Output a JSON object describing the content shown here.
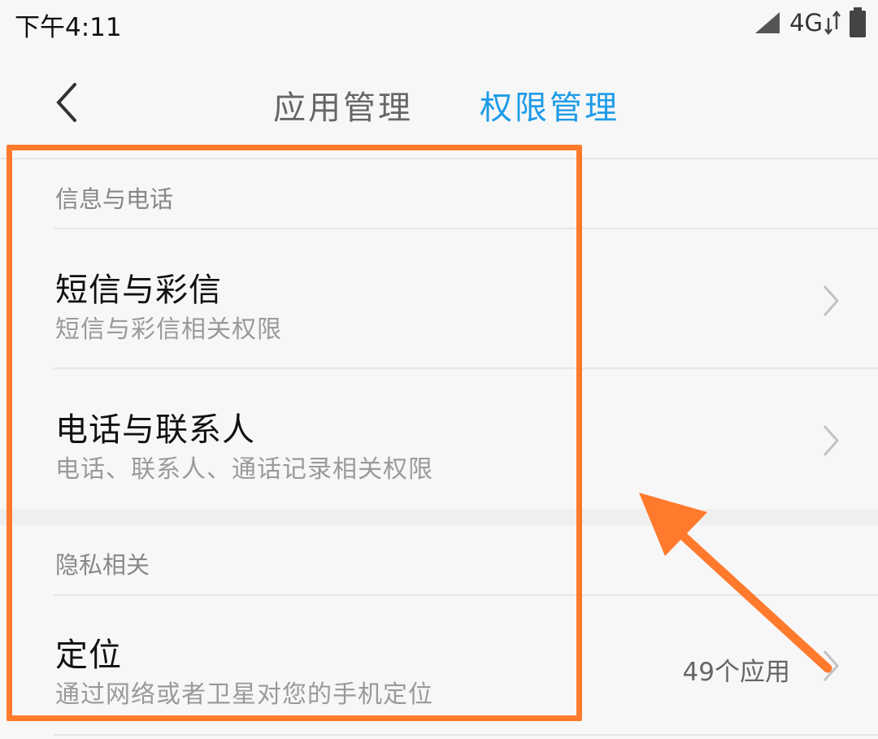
{
  "status_bar": {
    "time": "下午4:11",
    "network": "4G",
    "icons": [
      "signal-icon",
      "data-arrows-icon",
      "battery-icon"
    ]
  },
  "title_bar": {
    "back_icon": "chevron-left-icon",
    "tabs": [
      {
        "label": "应用管理",
        "active": false
      },
      {
        "label": "权限管理",
        "active": true
      }
    ],
    "active_color": "#1e9be8"
  },
  "sections": [
    {
      "header": "信息与电话",
      "items": [
        {
          "title": "短信与彩信",
          "subtitle": "短信与彩信相关权限",
          "meta": ""
        },
        {
          "title": "电话与联系人",
          "subtitle": "电话、联系人、通话记录相关权限",
          "meta": ""
        }
      ]
    },
    {
      "header": "隐私相关",
      "items": [
        {
          "title": "定位",
          "subtitle": "通过网络或者卫星对您的手机定位",
          "meta": "49个应用"
        }
      ]
    }
  ],
  "annotation": {
    "color": "#ff7a2c",
    "shapes": [
      "highlight-box",
      "pointer-arrow"
    ]
  }
}
